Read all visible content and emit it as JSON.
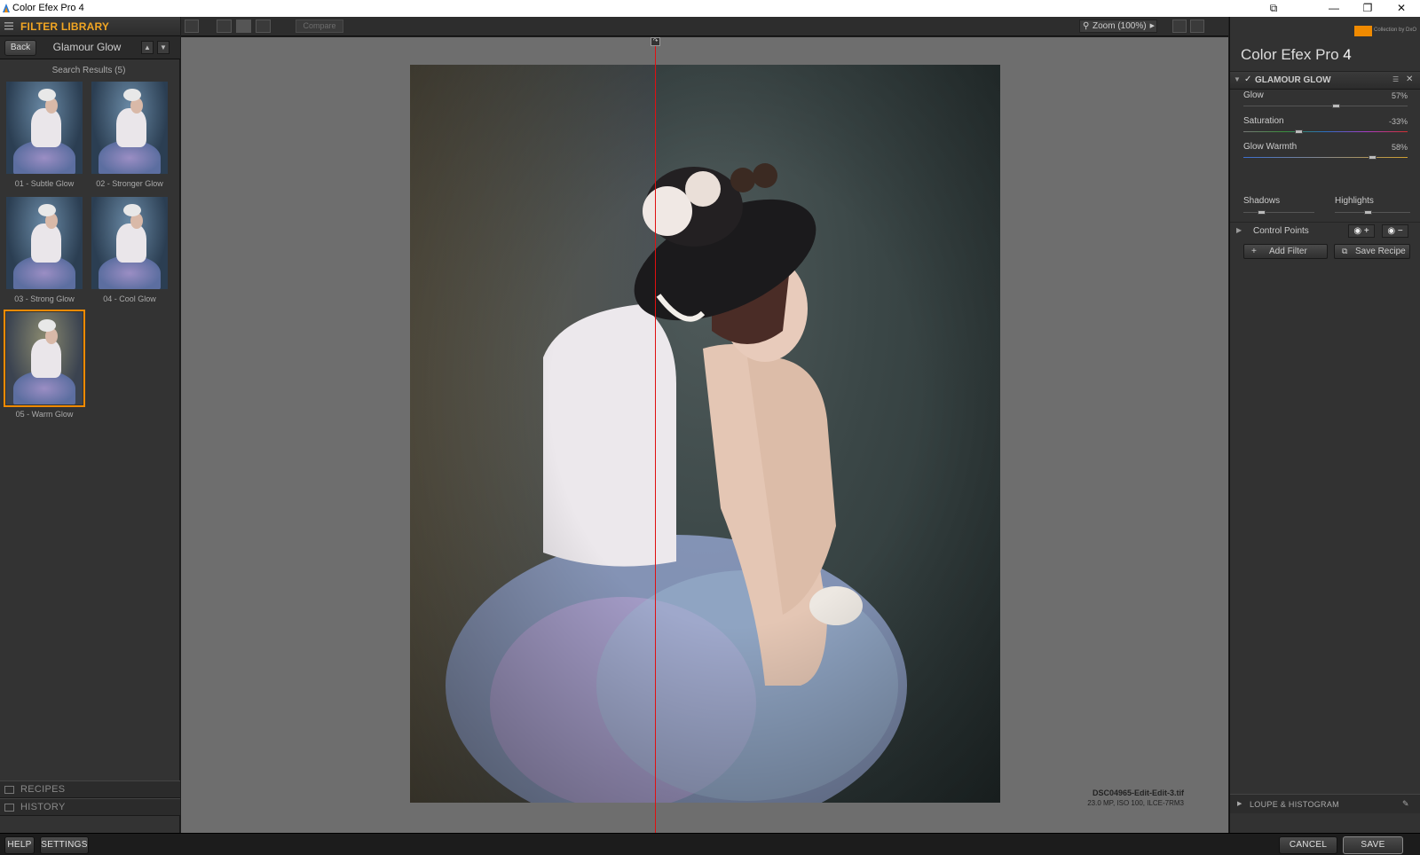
{
  "window": {
    "title": "Color Efex Pro 4",
    "controls": [
      "⧉",
      "—",
      "❐",
      "✕"
    ]
  },
  "library": {
    "header": "FILTER LIBRARY",
    "back_label": "Back",
    "nav_title": "Glamour Glow",
    "up_arrow": "▲",
    "down_arrow": "▼",
    "search_results": "Search Results (5)",
    "presets": [
      {
        "label": "01 - Subtle Glow"
      },
      {
        "label": "02 - Stronger Glow"
      },
      {
        "label": "03 - Strong Glow"
      },
      {
        "label": "04 - Cool Glow"
      },
      {
        "label": "05 - Warm Glow",
        "selected": true
      }
    ],
    "sections": [
      "RECIPES",
      "HISTORY"
    ]
  },
  "toolbar": {
    "compare_label": "Compare",
    "zoom_label": "Zoom (100%)"
  },
  "preview": {
    "split_handle": "↷",
    "filename": "DSC04965-Edit-Edit-3.tif",
    "file_meta": "23.0 MP, ISO 100, ILCE-7RM3",
    "split_line_color": "#e01010"
  },
  "panel": {
    "brand_text": "Collection by DxO",
    "app_title": "Color Efex Pro",
    "app_version": "4",
    "filter_name": "GLAMOUR GLOW",
    "filter_enabled": true,
    "sliders": [
      {
        "label": "Glow",
        "value": "57%",
        "fraction": 0.57
      },
      {
        "label": "Saturation",
        "value": "-33%",
        "fraction": 0.34
      },
      {
        "label": "Glow Warmth",
        "value": "58%",
        "fraction": 0.79
      }
    ],
    "shadows_label": "Shadows",
    "highlights_label": "Highlights",
    "control_points_label": "Control Points",
    "add_filter_label": "Add Filter",
    "save_recipe_label": "Save Recipe",
    "loupe_label": "LOUPE & HISTOGRAM"
  },
  "bottom": {
    "help_label": "HELP",
    "settings_label": "SETTINGS",
    "cancel_label": "CANCEL",
    "save_label": "SAVE"
  },
  "colors": {
    "accent": "#f2a623",
    "selection": "#f08a00"
  }
}
